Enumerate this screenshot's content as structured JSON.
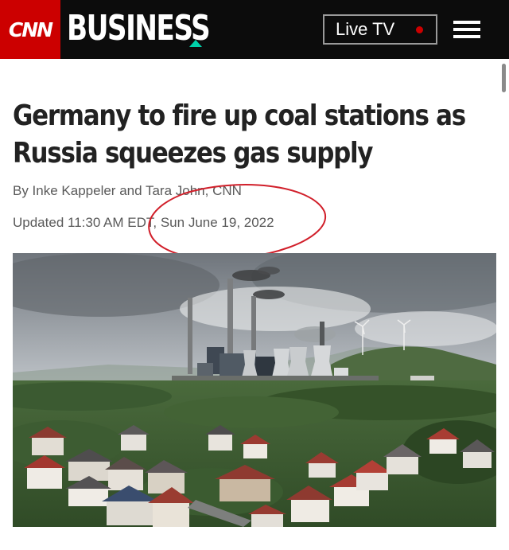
{
  "header": {
    "logo": "CNN",
    "section": "BUSINESS",
    "live_tv_label": "Live TV",
    "brand_color": "#cc0000",
    "accent_color": "#00d2aa"
  },
  "article": {
    "headline_line1": "Germany to fire up coal stations as",
    "headline_line2": "Russia squeezes gas supply",
    "byline": "By Inke Kappeler and Tara John, CNN",
    "timestamp": "Updated 11:30 AM EDT, Sun June 19, 2022"
  },
  "annotation": {
    "shape": "ellipse",
    "color": "#d11f2a"
  },
  "image": {
    "subject": "coal-power-station-with-cooling-towers-and-smokestacks-above-town"
  },
  "icons": {
    "menu": "hamburger-menu-icon",
    "live": "red-dot-icon"
  }
}
